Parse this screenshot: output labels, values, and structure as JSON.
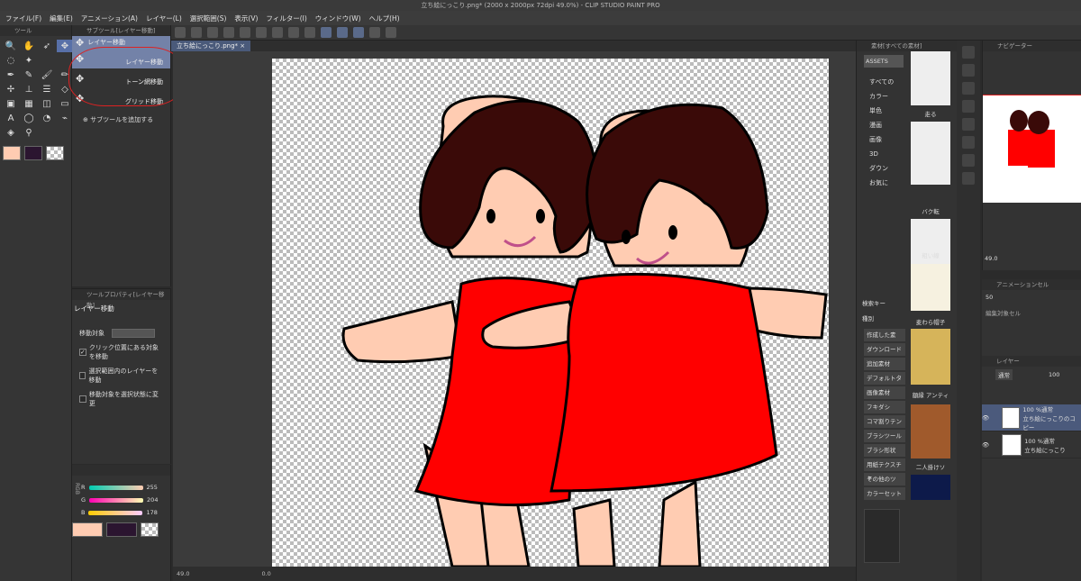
{
  "window": {
    "title": "立ち絵にっこり.png* (2000 x 2000px 72dpi 49.0%)  - CLIP STUDIO PAINT PRO"
  },
  "menu": [
    "ファイル(F)",
    "編集(E)",
    "アニメーション(A)",
    "レイヤー(L)",
    "選択範囲(S)",
    "表示(V)",
    "フィルター(I)",
    "ウィンドウ(W)",
    "ヘルプ(H)"
  ],
  "tool_panel": {
    "header": "ツール"
  },
  "subtool_panel": {
    "header": "サブツール[レイヤー移動]",
    "items": [
      "レイヤー移動",
      "レイヤー移動",
      "トーン網移動",
      "グリッド移動"
    ],
    "add_label": "サブツールを追加する"
  },
  "tool_property": {
    "header": "ツールプロパティ[レイヤー移動]",
    "title": "レイヤー移動",
    "move_target_label": "移動対象",
    "options": [
      {
        "label": "クリック位置にある対象を移動",
        "checked": true
      },
      {
        "label": "選択範囲内のレイヤーを移動",
        "checked": false
      },
      {
        "label": "移動対象を選択状態に変更",
        "checked": false
      }
    ]
  },
  "color": {
    "mode_label": "RGB",
    "r": 255,
    "g": 204,
    "b": 178,
    "labels": [
      "R",
      "G",
      "B"
    ],
    "main_color": "#ffccb2",
    "sub_color": "#2b1530"
  },
  "document": {
    "tab_label": "立ち絵にっこり.png*"
  },
  "status": {
    "zoom": "49.0",
    "angle": "0.0"
  },
  "materials": {
    "header": "素材[すべての素材]",
    "asset_label": "ASSETS",
    "tree": [
      "すべての",
      "カラー",
      "単色",
      "漫画",
      "画像",
      "3D",
      "ダウン",
      "お気に"
    ],
    "thumbs": [
      "走る",
      "バク転",
      "粗い線",
      "麦わら帽子",
      "額縁 アンティ",
      "二人掛けソ"
    ],
    "search_label": "検索キー",
    "kind_label": "種別",
    "filters": [
      "作成した素",
      "ダウンロード",
      "追加素材",
      "デフォルトタ",
      "画像素材",
      "フキダシ",
      "コマ割りテン",
      "ブラシツール",
      "ブラシ形状",
      "用紙テクスチャ",
      "その他のツ",
      "カラーセット"
    ]
  },
  "navigator": {
    "header": "ナビゲーター",
    "zoom": "49.0"
  },
  "animation": {
    "header": "アニメーションセル",
    "frame": "50",
    "label": "編集対象セル"
  },
  "layers": {
    "header": "レイヤー",
    "blend_mode": "通常",
    "opacity": "100",
    "rows": [
      {
        "line1": "100 %通常",
        "line2": "立ち絵にっこりのコピー",
        "selected": true
      },
      {
        "line1": "100 %通常",
        "line2": "立ち絵にっこり",
        "selected": false
      }
    ]
  },
  "colors": {
    "accent": "#5870a8",
    "annotation": "#dd2222",
    "dress": "#ff0000",
    "hair": "#3a0a08",
    "skin": "#ffccb2"
  }
}
